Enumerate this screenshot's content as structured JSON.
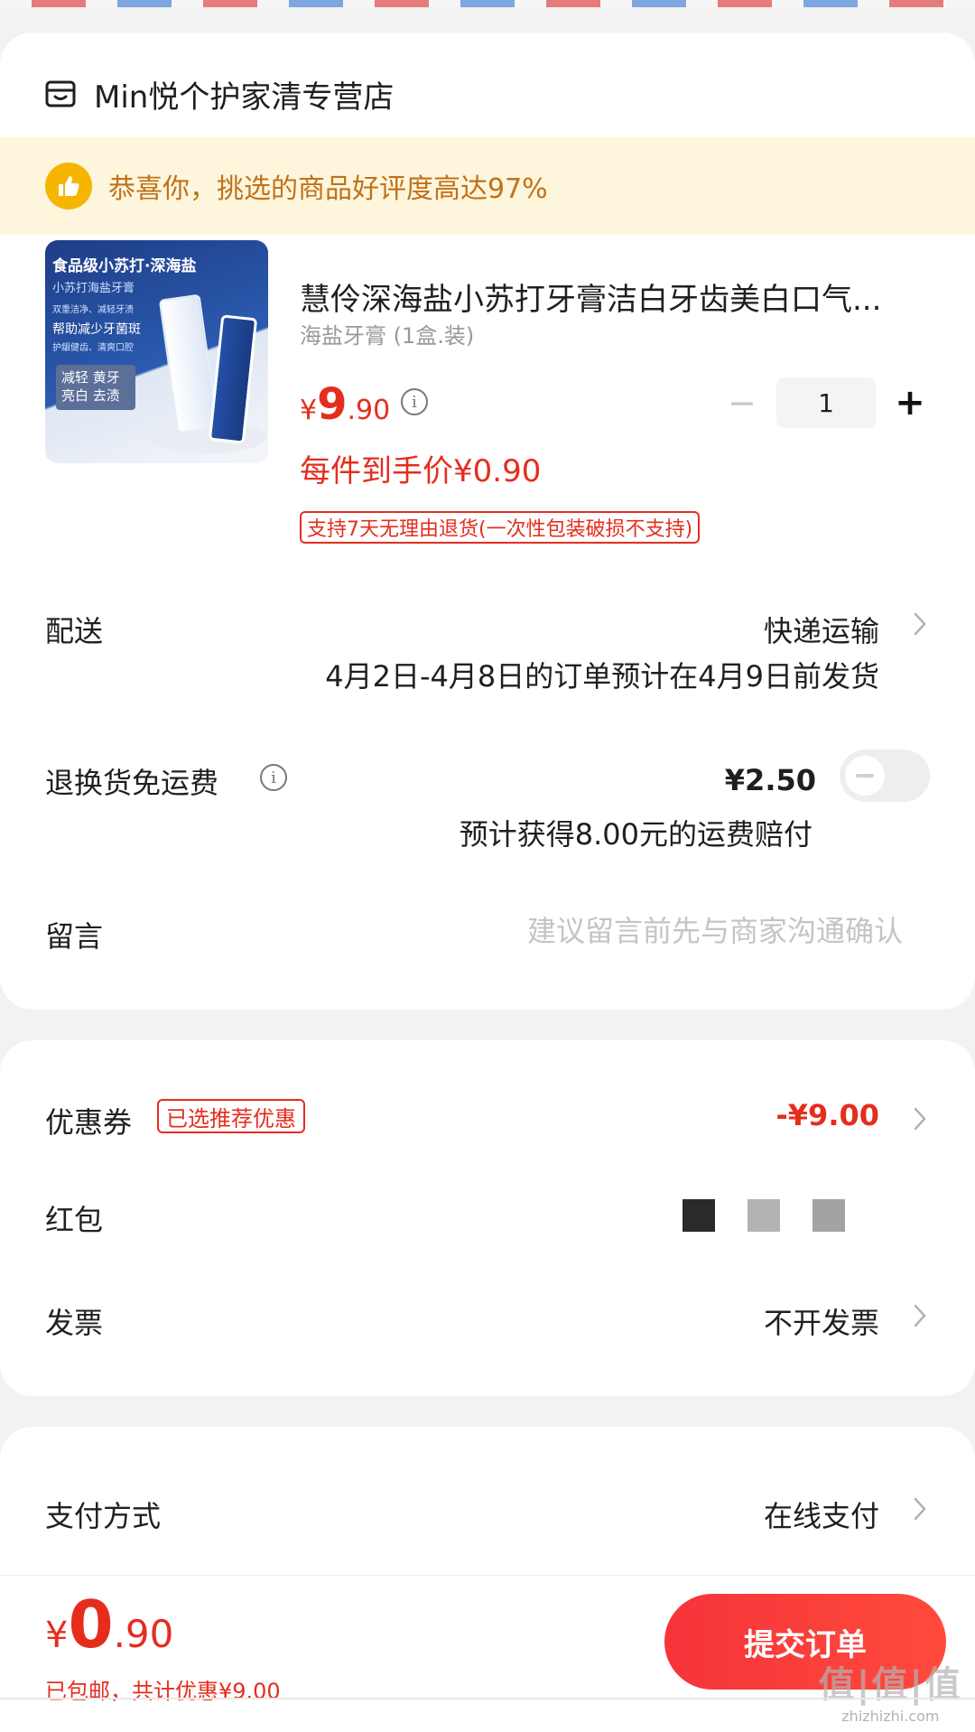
{
  "shop": {
    "name": "Min悦个护家清专营店",
    "icon": "shop-icon"
  },
  "banner": {
    "icon": "thumbs-up-icon",
    "text": "恭喜你，挑选的商品好评度高达97%",
    "colors": {
      "background": "#fdf6dc",
      "text": "#c0711a",
      "icon": "#f7b500"
    }
  },
  "product": {
    "image_text": {
      "title": "食品级小苏打·深海盐",
      "subtitle": "小苏打海盐牙膏",
      "line1": "双重洁净、减轻牙渍",
      "line2": "帮助减少牙菌斑",
      "line3": "护龈健齿、清爽口腔",
      "badge1": "减轻 黄牙",
      "badge2": "亮白 去渍"
    },
    "title": "慧伶深海盐小苏打牙膏洁白牙齿美白口气...",
    "spec": "海盐牙膏 (1盒.装)",
    "price_currency": "¥",
    "price_int": "9",
    "price_dec": ".90",
    "quantity": "1",
    "minus": "−",
    "plus": "+",
    "unit_price": "每件到手价¥0.90",
    "return_policy": "支持7天无理由退货(一次性包装破损不支持)"
  },
  "delivery": {
    "label": "配送",
    "value": "快递运输",
    "note": "4月2日-4月8日的订单预计在4月9日前发货"
  },
  "return_shipping": {
    "label": "退换货免运费",
    "price": "¥2.50",
    "enabled": false,
    "note": "预计获得8.00元的运费赔付"
  },
  "message": {
    "label": "留言",
    "placeholder": "建议留言前先与商家沟通确认",
    "value": ""
  },
  "coupon": {
    "label": "优惠券",
    "tag": "已选推荐优惠",
    "value": "-¥9.00"
  },
  "red_packet": {
    "label": "红包"
  },
  "invoice": {
    "label": "发票",
    "value": "不开发票"
  },
  "payment": {
    "label": "支付方式",
    "value": "在线支付"
  },
  "bottom": {
    "total_currency": "¥",
    "total_int": "0",
    "total_dec": ".90",
    "note": "已包邮，共计优惠¥9.00",
    "submit_label": "提交订单",
    "watermark": "值|值|值",
    "watermark_url": "zhizhizhi.com"
  },
  "colors": {
    "accent_red": "#e52d1e",
    "button_red": "#f5343a",
    "page_background": "#f2f2f2"
  }
}
